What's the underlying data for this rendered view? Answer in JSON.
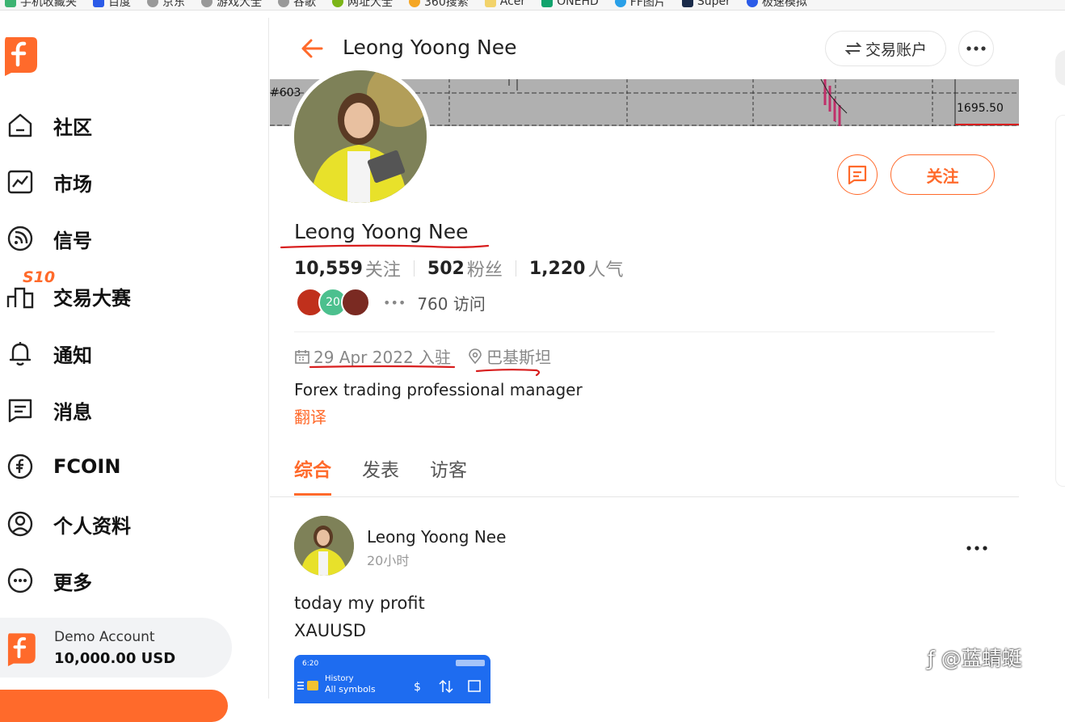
{
  "bookmarks": [
    "手机收藏夹",
    "百度",
    "京东",
    "游戏大全",
    "谷歌",
    "网址大全",
    "360搜索",
    "Acer",
    "ONEHD",
    "FF图片",
    "Super",
    "极速模拟"
  ],
  "sidebar": {
    "items": [
      {
        "label": "社区",
        "icon": "home-icon"
      },
      {
        "label": "市场",
        "icon": "chart-icon"
      },
      {
        "label": "信号",
        "icon": "signal-icon"
      },
      {
        "label": "交易大赛",
        "icon": "podium-icon"
      },
      {
        "label": "通知",
        "icon": "bell-icon"
      },
      {
        "label": "消息",
        "icon": "message-icon"
      },
      {
        "label": "FCOIN",
        "icon": "fcoin-icon"
      },
      {
        "label": "个人资料",
        "icon": "profile-icon"
      },
      {
        "label": "更多",
        "icon": "more-icon"
      }
    ],
    "contest_badge": "S10",
    "demo": {
      "name": "Demo Account",
      "balance": "10,000.00 USD"
    }
  },
  "header": {
    "title": "Leong Yoong Nee",
    "account_button": "交易账户",
    "more_icon": "ellipsis-icon"
  },
  "banner": {
    "left_label": "#603",
    "right_label": "1695.50"
  },
  "profile": {
    "name": "Leong Yoong Nee",
    "follow_button": "关注",
    "stats": [
      {
        "value": "10,559",
        "label": "关注"
      },
      {
        "value": "502",
        "label": "粉丝"
      },
      {
        "value": "1,220",
        "label": "人气"
      }
    ],
    "visitor_badge": "20",
    "visits_count": "760",
    "visits_label": "访问",
    "joined": "29 Apr 2022 入驻",
    "location": "巴基斯坦",
    "bio": "Forex trading professional manager",
    "translate": "翻译"
  },
  "tabs": [
    {
      "label": "综合",
      "active": true
    },
    {
      "label": "发表",
      "active": false
    },
    {
      "label": "访客",
      "active": false
    }
  ],
  "post": {
    "author": "Leong Yoong Nee",
    "time": "20小时",
    "line1": "today my profit",
    "line2": "XAUUSD",
    "image": {
      "time": "6:20",
      "history": "History",
      "symbols": "All symbols"
    }
  },
  "watermark": "@蓝蜻蜓",
  "colors": {
    "accent": "#ff6a2b",
    "annotation": "#d81e1e"
  }
}
